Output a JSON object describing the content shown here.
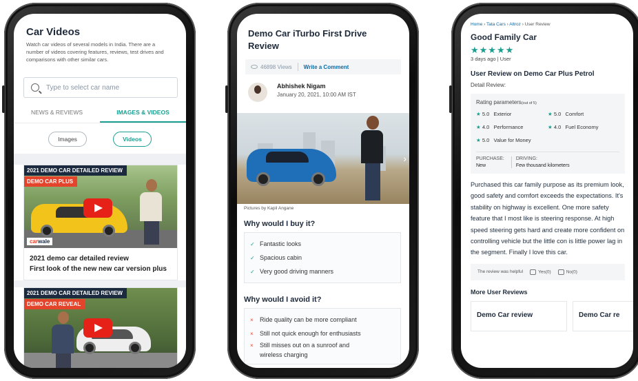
{
  "phone1": {
    "title": "Car Videos",
    "description": "Watch car videos of several models in India. There are a number of videos covering features, reviews, test drives and comparisons with other similar cars.",
    "search_placeholder": "Type to select car name",
    "tabs": [
      {
        "label": "NEWS & REVIEWS"
      },
      {
        "label": "IMAGES & VIDEOS"
      }
    ],
    "filters": [
      {
        "label": "Images"
      },
      {
        "label": "Videos"
      }
    ],
    "videos": [
      {
        "tag": "2021 DEMO CAR DETAILED REVIEW",
        "badge": "DEMO CAR PLUS",
        "brand_prefix": "car",
        "brand_suffix": "wale",
        "title": "2021 demo car detailed review",
        "subtitle": "First look of the new new car version plus"
      },
      {
        "tag": "2021 DEMO CAR DETAILED REVIEW",
        "badge": "DEMO CAR REVEAL"
      }
    ]
  },
  "phone2": {
    "title": "Demo Car iTurbo First Drive Review",
    "views": "46898 Views",
    "write_comment": "Write a Comment",
    "author": {
      "name": "Abhishek Nigam",
      "date": "January 20, 2021, 10:00 AM IST"
    },
    "caption": "Pictures by Kapil Angane",
    "buy_title": "Why would I buy it?",
    "buy_items": [
      "Fantastic looks",
      "Spacious cabin",
      "Very good driving manners"
    ],
    "avoid_title": "Why would I avoid it?",
    "avoid_items": [
      "Ride quality can be more compliant",
      "Still not quick enough for enthusiasts",
      "Still misses out on a sunroof and",
      "wireless charging"
    ],
    "icons": {
      "buy": "✓",
      "avoid": "×",
      "next": "›"
    }
  },
  "phone3": {
    "breadcrumb": [
      "Home",
      "Tata Cars",
      "Altroz",
      "User Review"
    ],
    "title": "Good Family Car",
    "stars": "★★★★★",
    "meta": "3 days ago | User",
    "review_title": "User Review on Demo Car Plus Petrol",
    "detail_label": "Detail Review:",
    "rating_label": "Rating parameters",
    "rating_note": "(out of 5)",
    "ratings": [
      {
        "score": "5.0",
        "name": "Exterior"
      },
      {
        "score": "5.0",
        "name": "Comfort"
      },
      {
        "score": "4.0",
        "name": "Performance"
      },
      {
        "score": "4.0",
        "name": "Fuel Economy"
      },
      {
        "score": "5.0",
        "name": "Value for Money"
      }
    ],
    "purchase": {
      "label": "PURCHASE:",
      "value": "New"
    },
    "driving": {
      "label": "DRIVING:",
      "value": "Few thousand kilometers"
    },
    "review_text": "Purchased this car family purpose as its premium look, good safety and comfort exceeds the expectations. It's stability on highway is excellent. One more safety feature that I most like is steering response. At high speed steering gets hard and create more confident on controlling vehicle but the little con is little power lag in the segment. Finally I love this car.",
    "helpful": {
      "prompt": "The review was helpful",
      "yes": "Yes(0)",
      "no": "No(0)"
    },
    "more_title": "More User Reviews",
    "more_cards": [
      "Demo Car review",
      "Demo Car re"
    ]
  },
  "colors": {
    "accent": "#1a9e8f",
    "link": "#0a6aa6",
    "red": "#e4442c",
    "navy": "#1b2a3f"
  }
}
